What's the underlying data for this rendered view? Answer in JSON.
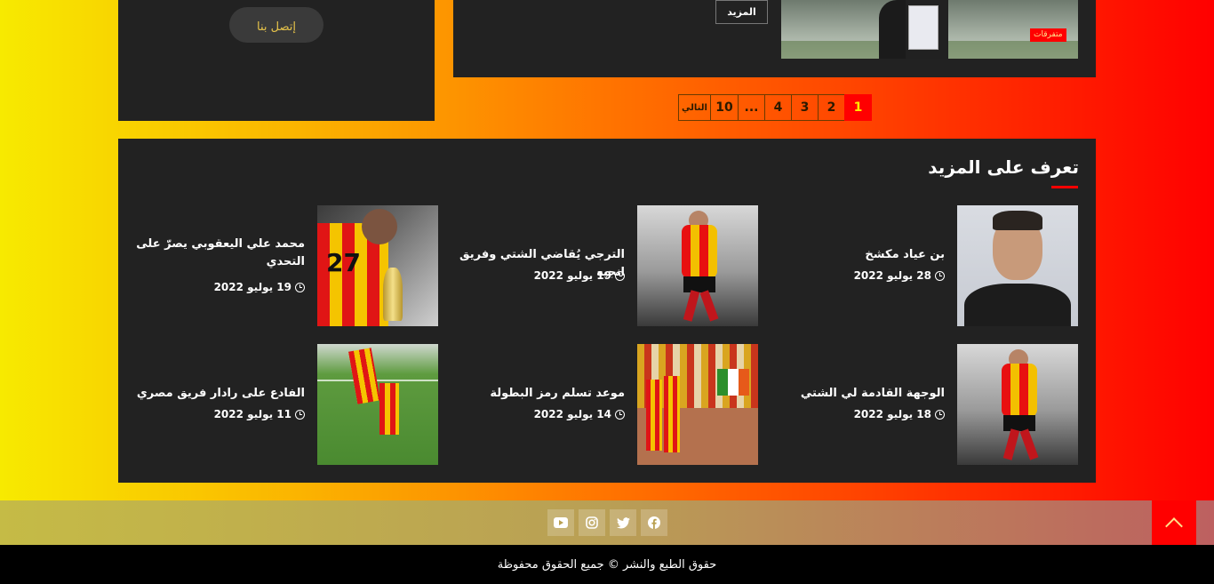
{
  "sidebar": {
    "contact_label": "إتصل بنا"
  },
  "post": {
    "more_label": "المزيد",
    "category": "متفرقات"
  },
  "pagination": {
    "next_label": "التالي",
    "pages": [
      "10",
      "...",
      "4",
      "3",
      "2",
      "1"
    ],
    "active": "1"
  },
  "learn_more": {
    "title": "تعرف على المزيد",
    "items": [
      {
        "title": "بن عياد مكشخ",
        "date": "28 يوليو 2022",
        "thumb": "portrait"
      },
      {
        "title": "الترجي يُقاضي الشتي وفريق انجيه",
        "date": "19 يوليو 2022",
        "thumb": "player"
      },
      {
        "title": "محمد علي اليعقوبي يصرّ على التحدي",
        "date": "19 يوليو 2022",
        "thumb": "trophy"
      },
      {
        "title": "الوجهة القادمة لي الشتي",
        "date": "18 يوليو 2022",
        "thumb": "player"
      },
      {
        "title": "موعد تسلم رمز البطولة",
        "date": "14 يوليو 2022",
        "thumb": "crowd"
      },
      {
        "title": "الفادع على رادار فريق مصري",
        "date": "11 يوليو 2022",
        "thumb": "pitch"
      }
    ]
  },
  "social": {
    "icons": [
      "youtube-icon",
      "instagram-icon",
      "twitter-icon",
      "facebook-icon"
    ]
  },
  "footer": {
    "copyright": "حقوق الطبع والنشر © جميع الحقوق محفوظة"
  },
  "colors": {
    "accent": "#ff0000",
    "card_bg": "#222222",
    "gold": "#e6c34a"
  }
}
